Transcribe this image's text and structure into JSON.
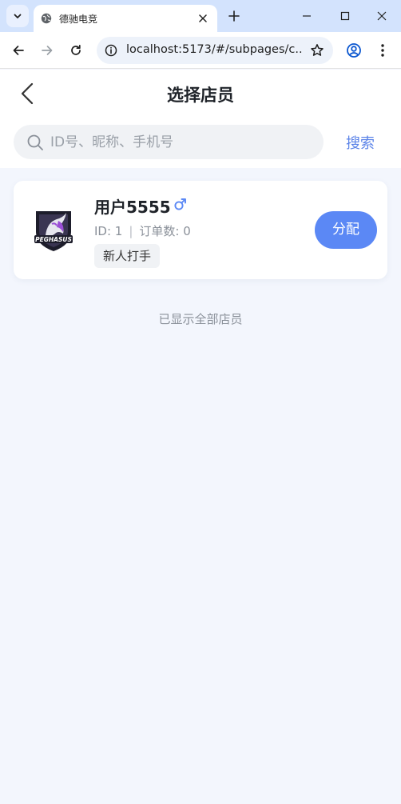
{
  "browser": {
    "tab_title": "德驰电竞",
    "url": "localhost:5173/#/subpages/c...",
    "icons": {
      "tab_menu": "chevron-down-icon",
      "favicon": "globe-icon",
      "tab_close": "close-icon",
      "new_tab": "plus-icon",
      "minimize": "minimize-icon",
      "maximize": "maximize-icon",
      "close_window": "close-icon",
      "back": "arrow-left-icon",
      "forward": "arrow-right-icon",
      "reload": "reload-icon",
      "site_info": "info-icon",
      "bookmark": "star-icon",
      "profile": "profile-icon",
      "menu": "more-vertical-icon"
    }
  },
  "header": {
    "title": "选择店员",
    "back_icon": "chevron-left-icon"
  },
  "search": {
    "placeholder": "ID号、昵称、手机号",
    "value": "",
    "button_label": "搜索",
    "icon": "search-icon"
  },
  "staff": [
    {
      "name": "用户5555",
      "gender_icon": "male-icon",
      "id_text": "ID: 1",
      "orders_text": "订单数: 0",
      "tag": "新人打手",
      "avatar_logo_text": "PEGHASUS",
      "assign_label": "分配"
    }
  ],
  "footer_note": "已显示全部店员",
  "colors": {
    "accent": "#5b88f5",
    "link": "#5b83e8",
    "gender_male": "#5b88f5",
    "page_bg": "#f3f6fd"
  }
}
